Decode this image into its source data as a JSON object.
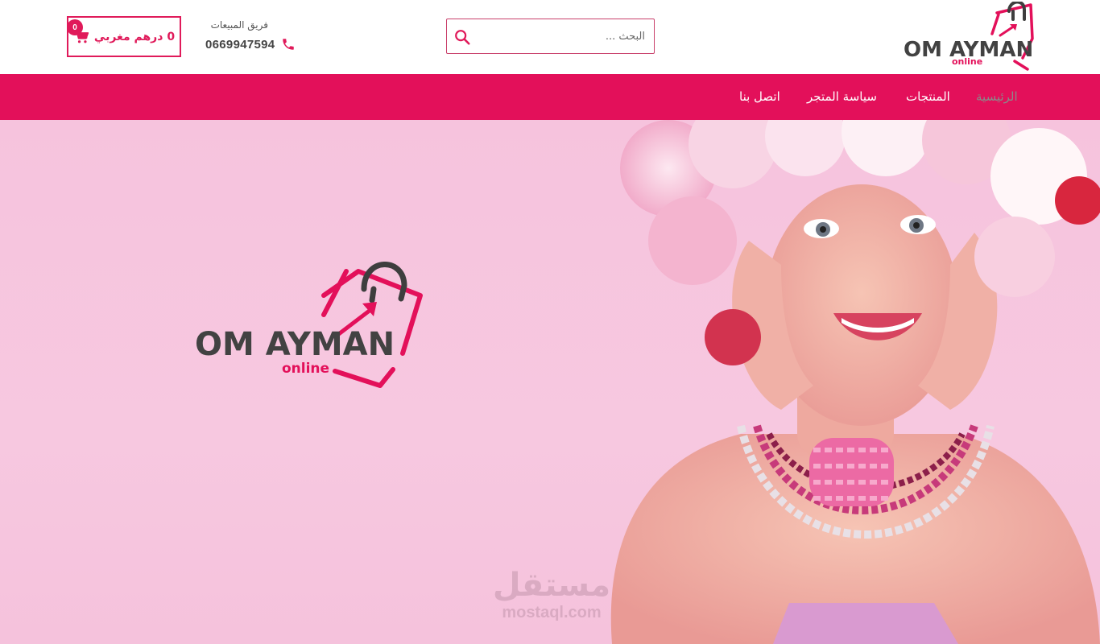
{
  "header": {
    "cart": {
      "amount_label": "0 درهم مغربي",
      "count": "0",
      "icon": "cart-icon"
    },
    "sales": {
      "label": "فريق المبيعات",
      "phone": "0669947594",
      "icon": "phone-icon"
    },
    "search": {
      "placeholder": "البحث ...",
      "value": "",
      "icon": "search-icon"
    },
    "logo": {
      "brand": "OM AYMAN",
      "tagline": "online"
    }
  },
  "nav": {
    "items": [
      {
        "label": "الرئيسية",
        "active": true
      },
      {
        "label": "المنتجات",
        "active": false
      },
      {
        "label": "سياسة المتجر",
        "active": false
      },
      {
        "label": "اتصل بنا",
        "active": false
      }
    ]
  },
  "hero": {
    "logo": {
      "brand": "OM AYMAN",
      "tagline": "online"
    },
    "watermark": {
      "arabic": "مستقل",
      "latin": "mostaql.com"
    }
  },
  "colors": {
    "brand": "#e3105a",
    "brand_dark": "#424242",
    "hero_bg": "#f6c3dd",
    "nav_text": "#ffffff",
    "nav_active_text": "#8a8a8a"
  }
}
